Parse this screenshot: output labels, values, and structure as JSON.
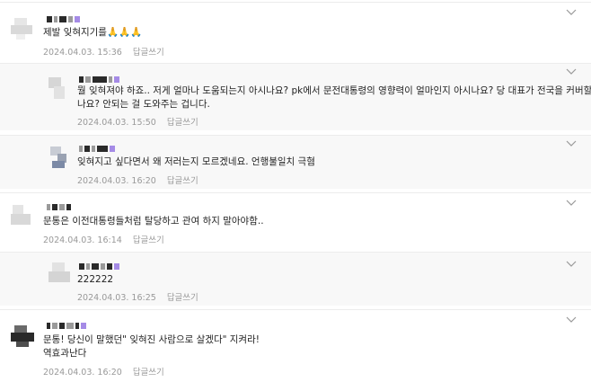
{
  "comments": [
    {
      "text": "제발 잊혀지기를🙏🙏🙏",
      "date": "2024.04.03. 15:36",
      "reply_label": "답글쓰기"
    },
    {
      "text_line1": "뭘 잊혀져야 하죠.. 저게 얼마나 도움되는지 아시나요? pk에서 문전대통령의 영향력이 얼마인지 아시나요? 당 대표가 전국을 커버할수 있",
      "text_line2": "나요? 안되는 걸 도와주는 겁니다.",
      "date": "2024.04.03. 15:50",
      "reply_label": "답글쓰기"
    },
    {
      "text": "잊혀지고 싶다면서 왜 저러는지 모르겠네요. 언행불일치 극혐",
      "date": "2024.04.03. 16:20",
      "reply_label": "답글쓰기"
    },
    {
      "text": "문통은 이전대통령들처럼 탈당하고 관여 하지 말아야함..",
      "date": "2024.04.03. 16:14",
      "reply_label": "답글쓰기"
    },
    {
      "text": "222222",
      "date": "2024.04.03. 16:25",
      "reply_label": "답글쓰기"
    },
    {
      "text_line1": "문통! 당신이 말했던\" 잊혀진 사람으로 살겠다\" 지켜라!",
      "text_line2": "역효과난다",
      "date": "2024.04.03. 16:20",
      "reply_label": "답글쓰기"
    }
  ],
  "icons": {
    "more": "more-options-icon"
  },
  "colors": {
    "accent": "#a58be6",
    "meta": "#999999",
    "reply_bg": "#f8f8f8"
  }
}
